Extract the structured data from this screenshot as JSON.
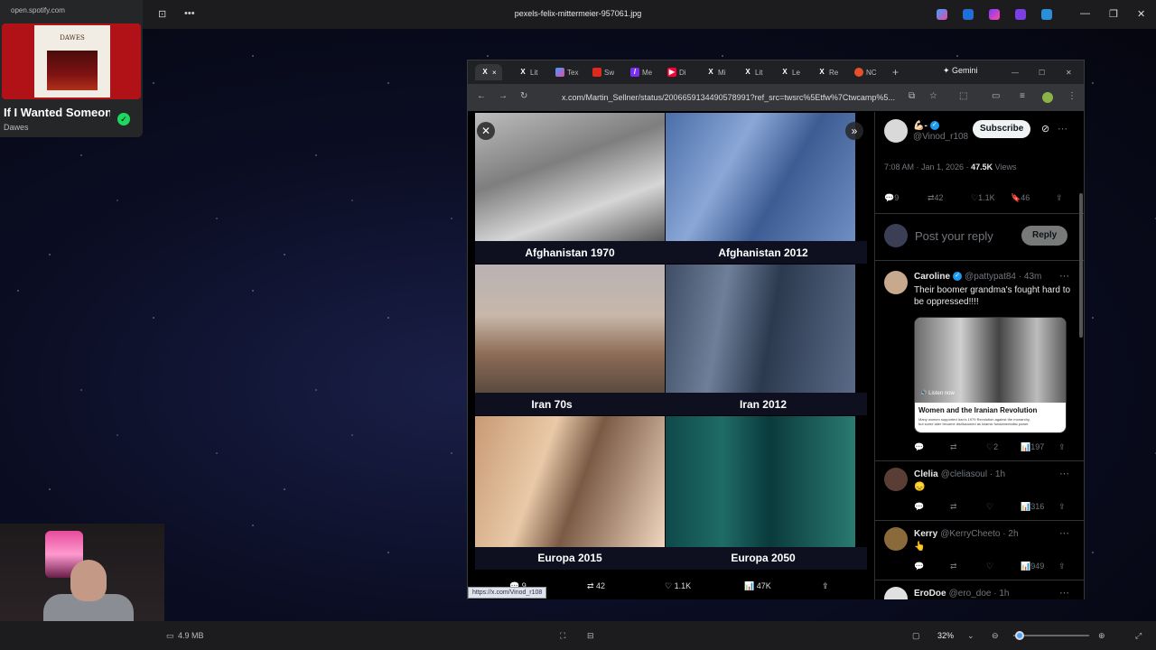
{
  "viewer": {
    "filename": "pexels-felix-mittermeier-957061.jpg",
    "file_size": "4.9 MB",
    "zoom": "32%"
  },
  "spotify": {
    "url": "open.spotify.com",
    "album_art_text": "DAWES",
    "song": "If I Wanted Someone",
    "artist": "Dawes"
  },
  "browser": {
    "tabs": [
      {
        "label": "×",
        "icon": "x-logo"
      },
      {
        "label": "Lit",
        "icon": "x-logo"
      },
      {
        "label": "Tex",
        "icon": "copilot"
      },
      {
        "label": "Sw",
        "icon": "app-red"
      },
      {
        "label": "Me",
        "icon": "app-purple"
      },
      {
        "label": "Di",
        "icon": "youtube"
      },
      {
        "label": "Mi",
        "icon": "x-logo"
      },
      {
        "label": "Lit",
        "icon": "x-logo"
      },
      {
        "label": "Le",
        "icon": "x-logo"
      },
      {
        "label": "Re",
        "icon": "x-logo"
      },
      {
        "label": "NC",
        "icon": "app-orange"
      }
    ],
    "gemini_label": "Gemini",
    "url": "x.com/Martin_Sellner/status/2006659134490578991?ref_src=twsrc%5Etfw%7Ctwcamp%5..."
  },
  "media": {
    "captions": [
      "Afghanistan 1970",
      "Afghanistan 2012",
      "Iran 70s",
      "Iran 2012",
      "Europa 2015",
      "Europa 2050"
    ],
    "actions": {
      "replies": "9",
      "reposts": "42",
      "likes": "1.1K",
      "views": "47K"
    },
    "status_url": "https://x.com/Vinod_r108"
  },
  "post": {
    "author_name": "💪🏻-",
    "author_handle": "@Vinod_r108",
    "subscribe_label": "Subscribe",
    "time": "7:08 AM · Jan 1, 2026",
    "views": "47.5K",
    "views_label": "Views",
    "replies": "9",
    "reposts": "42",
    "likes": "1.1K",
    "bookmarks": "46",
    "reply_placeholder": "Post your reply",
    "reply_button": "Reply"
  },
  "replies": [
    {
      "name": "Caroline",
      "handle": "@pattypat84 · 43m",
      "text": "Their boomer grandma's fought hard to be oppressed!!!!",
      "embed_title": "Women and the Iranian Revolution",
      "embed_listen": "Listen now",
      "embed_sub": "Many women supported Iran's 1979 Revolution against the monarchy, but some later became disillusioned as Islamic fundamentalist power.",
      "replies": "",
      "reposts": "",
      "likes": "2",
      "views": "197"
    },
    {
      "name": "Clelia",
      "handle": "@cleliasoul · 1h",
      "text": "😞",
      "views": "316"
    },
    {
      "name": "Kerry",
      "handle": "@KerryCheeto · 2h",
      "text": "👆",
      "views": "949"
    },
    {
      "name": "EroDoe",
      "handle": "@ero_doe · 1h",
      "text": ""
    }
  ],
  "colors": {
    "accent": "#1d9bf0",
    "spotify_green": "#1ed760",
    "spotify_red": "#b01218"
  }
}
